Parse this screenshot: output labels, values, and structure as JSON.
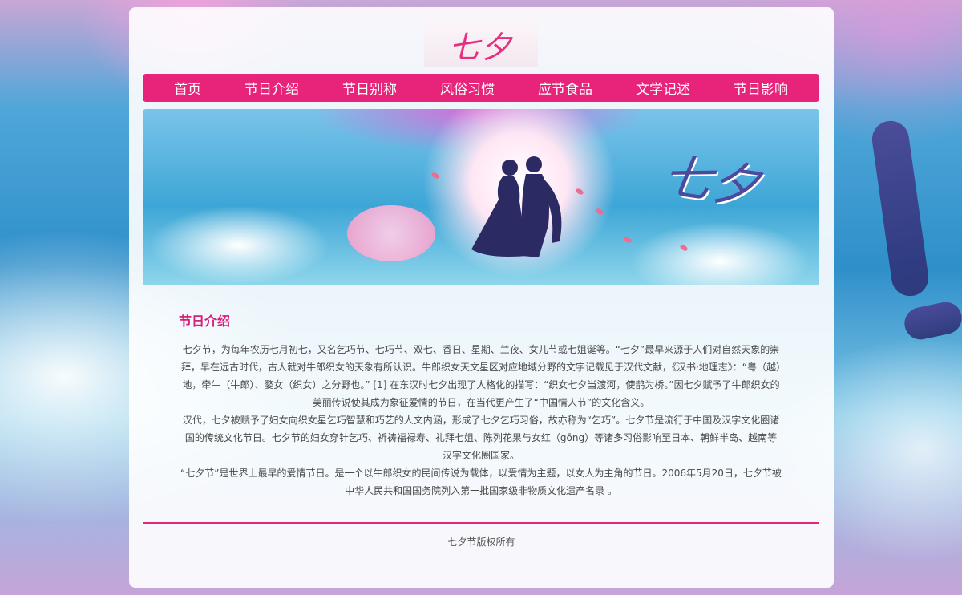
{
  "logo": {
    "text": "七夕"
  },
  "nav": {
    "items": [
      "首页",
      "节日介绍",
      "节日别称",
      "风俗习惯",
      "应节食品",
      "文学记述",
      "节日影响"
    ]
  },
  "banner": {
    "title": "七夕"
  },
  "section": {
    "title": "节日介绍",
    "paragraphs": [
      "七夕节，为每年农历七月初七，又名乞巧节、七巧节、双七、香日、星期、兰夜、女儿节或七姐诞等。“七夕”最早来源于人们对自然天象的崇拜，早在远古时代，古人就对牛郎织女的天象有所认识。牛郎织女天文星区对应地域分野的文字记载见于汉代文献，《汉书·地理志》：“粤（越）地，牵牛（牛郎）、婺女（织女）之分野也。” [1] 在东汉时七夕出现了人格化的描写：“织女七夕当渡河，使鹊为桥。”因七夕赋予了牛郎织女的美丽传说使其成为象征爱情的节日，在当代更产生了“中国情人节”的文化含义。",
      "汉代，七夕被赋予了妇女向织女星乞巧智慧和巧艺的人文内涵，形成了七夕乞巧习俗，故亦称为“乞巧”。七夕节是流行于中国及汉字文化圈诸国的传统文化节日。七夕节的妇女穿针乞巧、祈祷福禄寿、礼拜七姐、陈列花果与女红（gōng）等诸多习俗影响至日本、朝鲜半岛、越南等汉字文化圈国家。",
      "“七夕节”是世界上最早的爱情节日。是一个以牛郎织女的民间传说为载体，以爱情为主题，以女人为主角的节日。2006年5月20日，七夕节被中华人民共和国国务院列入第一批国家级非物质文化遗产名录 。"
    ]
  },
  "footer": {
    "copyright": "七夕节版权所有"
  },
  "colors": {
    "accent": "#e8247a",
    "title": "#d6207a"
  },
  "icons": {
    "couple": "couple-silhouette"
  }
}
